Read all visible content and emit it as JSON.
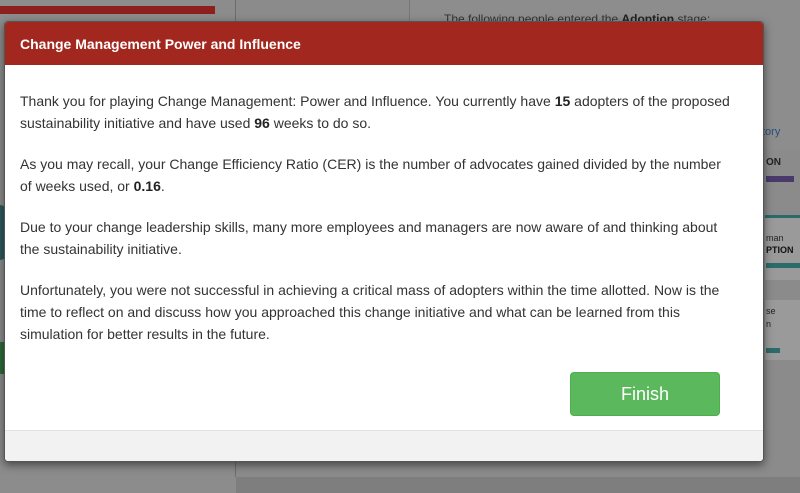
{
  "background": {
    "panel_text_prefix": "The following people entered the ",
    "panel_text_bold": "Adoption",
    "panel_text_suffix": " stage:",
    "history_fragment": "tory",
    "on_fragment": "ON",
    "man_fragment": "man",
    "ption_fragment": "PTION",
    "se_fragment": "se",
    "n_fragment": "n"
  },
  "modal": {
    "title": "Change Management Power and Influence",
    "p1": {
      "a": "Thank you for playing Change Management: Power and Influence. You currently have ",
      "adopters": "15",
      "b": " adopters of the proposed sustainability initiative and have used ",
      "weeks": "96",
      "c": " weeks to do so."
    },
    "p2": {
      "a": "As you may recall, your Change Efficiency Ratio (CER) is the number of advocates gained divided by the number of weeks used, or ",
      "cer": "0.16",
      "b": "."
    },
    "p3": "Due to your change leadership skills, many more employees and managers are now aware of and thinking about the sustainability initiative.",
    "p4": "Unfortunately, you were not successful in achieving a critical mass of adopters within the time allotted. Now is the time to reflect on and discuss how you approached this change initiative and what can be learned from this simulation for better results in the future.",
    "finish_label": "Finish"
  },
  "colors": {
    "header": "#a2281f",
    "finish_button": "#5cb85c"
  }
}
